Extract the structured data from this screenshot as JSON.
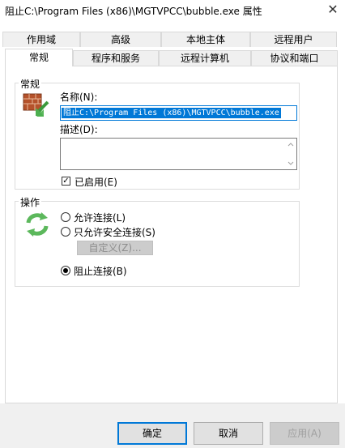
{
  "window": {
    "title": "阻止C:\\Program Files (x86)\\MGTVPCC\\bubble.exe 属性",
    "close_glyph": "✕"
  },
  "tabs": {
    "top_row": [
      "作用域",
      "高级",
      "本地主体",
      "远程用户"
    ],
    "bottom_row": [
      "常规",
      "程序和服务",
      "远程计算机",
      "协议和端口"
    ],
    "active": "常规"
  },
  "general": {
    "group_title": "常规",
    "icon": "firewall-icon",
    "name_label": "名称(N):",
    "name_value": "阻止C:\\Program Files (x86)\\MGTVPCC\\bubble.exe",
    "description_label": "描述(D):",
    "description_value": "",
    "enabled_label": "已启用(E)",
    "enabled": true
  },
  "action": {
    "group_title": "操作",
    "icon": "refresh-arrows-icon",
    "options": [
      "允许连接(L)",
      "只允许安全连接(S)",
      "阻止连接(B)"
    ],
    "selected": "阻止连接(B)",
    "customize_label": "自定义(Z)..."
  },
  "buttons": {
    "ok": "确定",
    "cancel": "取消",
    "apply": "应用(A)"
  },
  "colors": {
    "accent": "#0078d7",
    "icon_green": "#5cb85c",
    "firewall_brick": "#b5522b"
  }
}
